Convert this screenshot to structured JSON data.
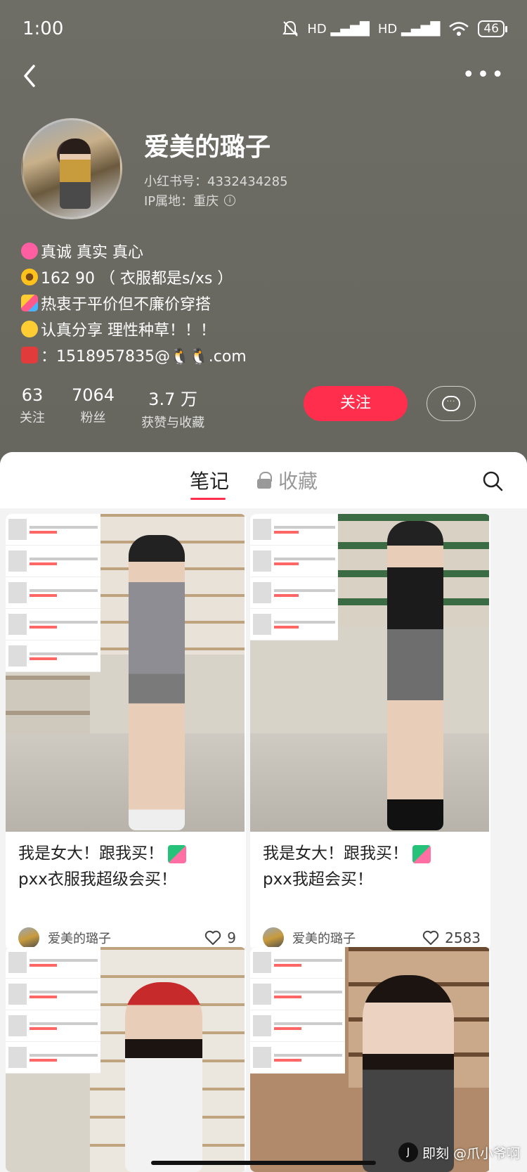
{
  "status_bar": {
    "time": "1:00",
    "battery": "46",
    "signal1": "HD",
    "signal2": "HD"
  },
  "profile": {
    "name": "爱美的璐子",
    "red_id": "小红书号：4332434285",
    "ip_location": "IP属地：重庆",
    "bio": [
      {
        "emoji": "heart",
        "text": "真诚 真实 真心"
      },
      {
        "emoji": "sunflower",
        "text": "162 90 （ 衣服都是s/xs ）"
      },
      {
        "emoji": "party",
        "text": "热衷于平价但不廉价穿搭"
      },
      {
        "emoji": "smile",
        "text": "认真分享 理性种草！！！"
      },
      {
        "emoji": "mailbox",
        "text": "：1518957835@🐧🐧.com"
      }
    ],
    "stats": [
      {
        "value": "63",
        "label": "关注"
      },
      {
        "value": "7064",
        "label": "粉丝"
      },
      {
        "value": "3.7 万",
        "label": "获赞与收藏"
      }
    ],
    "follow_label": "关注"
  },
  "tabs": {
    "notes": "笔记",
    "collect": "收藏"
  },
  "notes": [
    {
      "title_line1": "我是女大！跟我买！",
      "title_line2": "pxx衣服我超级会买！",
      "author": "爱美的璐子",
      "likes": "9"
    },
    {
      "title_line1": "我是女大！跟我买！",
      "title_line2": "pxx我超会买！",
      "author": "爱美的璐子",
      "likes": "2583"
    }
  ],
  "watermark": "即刻 @爪小爷啊",
  "colors": {
    "accent": "#ff2e4d",
    "header_bg": "#6a6a62"
  }
}
